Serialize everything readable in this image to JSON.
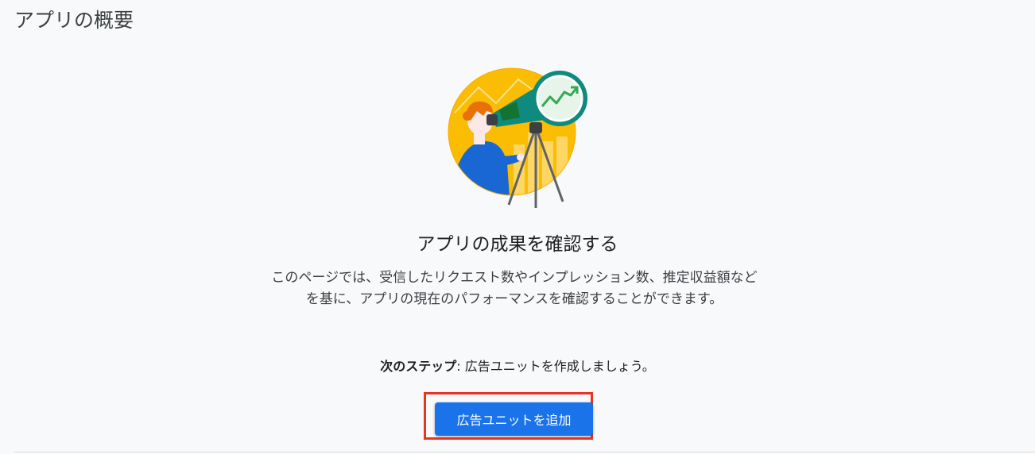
{
  "page": {
    "title": "アプリの概要"
  },
  "empty_state": {
    "heading": "アプリの成果を確認する",
    "description": "このページでは、受信したリクエスト数やインプレッション数、推定収益額などを基に、アプリの現在のパフォーマンスを確認することができます。",
    "next_step_label": "次のステップ",
    "next_step_text": ": 広告ユニットを作成しましょう。",
    "add_button_label": "広告ユニットを追加"
  },
  "colors": {
    "accent": "#1a73e8",
    "highlight": "#ea3323",
    "illustration_yellow": "#fbbc04",
    "illustration_teal": "#0f8a7e"
  },
  "icons": {
    "illustration": "telescope-person-illustration"
  }
}
